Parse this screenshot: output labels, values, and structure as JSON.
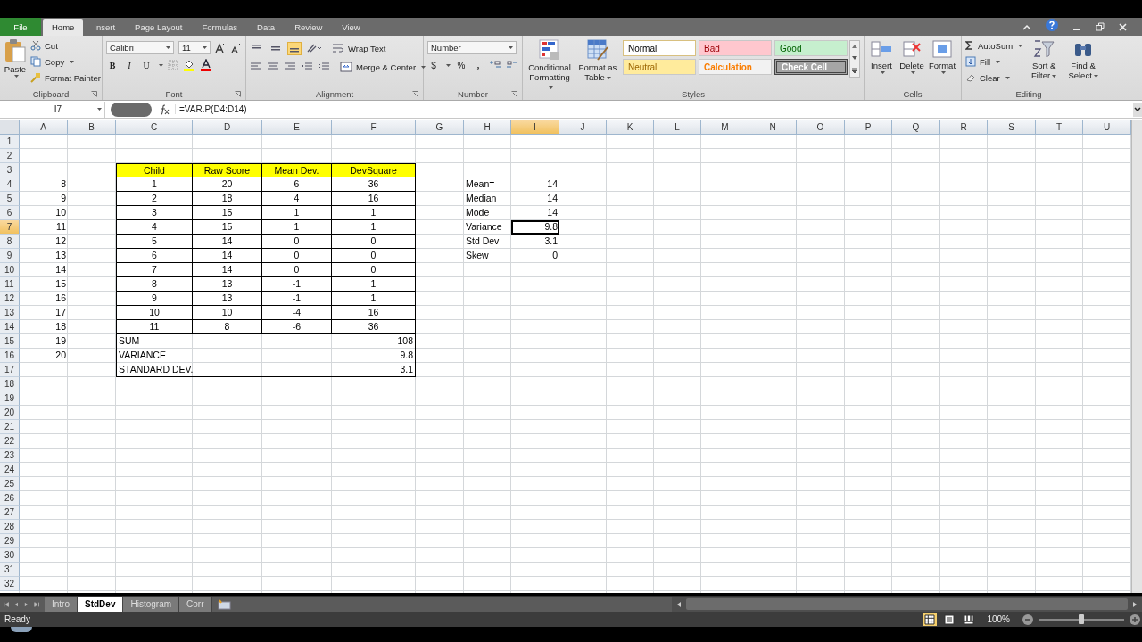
{
  "ribbon_tabs": [
    {
      "label": "File",
      "kind": "file",
      "selected": false
    },
    {
      "label": "Home",
      "kind": "tab",
      "selected": true
    },
    {
      "label": "Insert",
      "kind": "tab",
      "selected": false
    },
    {
      "label": "Page Layout",
      "kind": "tab",
      "selected": false
    },
    {
      "label": "Formulas",
      "kind": "tab",
      "selected": false
    },
    {
      "label": "Data",
      "kind": "tab",
      "selected": false
    },
    {
      "label": "Review",
      "kind": "tab",
      "selected": false
    },
    {
      "label": "View",
      "kind": "tab",
      "selected": false
    }
  ],
  "ribbon": {
    "clipboard": {
      "title": "Clipboard",
      "paste": "Paste",
      "cut": "Cut",
      "copy": "Copy",
      "format_painter": "Format Painter"
    },
    "font": {
      "title": "Font",
      "name": "Calibri",
      "size": "11",
      "bold": "B",
      "italic": "I",
      "underline": "U"
    },
    "alignment": {
      "title": "Alignment",
      "vertical": [
        {
          "selected": false
        },
        {
          "selected": false
        },
        {
          "selected": true
        }
      ],
      "wrap_text": "Wrap Text",
      "merge_center": "Merge & Center"
    },
    "number": {
      "title": "Number",
      "format": "Number",
      "currency": "$",
      "percent": "%",
      "comma": ","
    },
    "styles": {
      "title": "Styles",
      "conditional_formatting": "Conditional Formatting",
      "format_as_table": "Format as Table",
      "cell_styles": [
        {
          "label": "Normal",
          "kind": "normal"
        },
        {
          "label": "Bad",
          "kind": "bad"
        },
        {
          "label": "Good",
          "kind": "good"
        },
        {
          "label": "Neutral",
          "kind": "neutral"
        },
        {
          "label": "Calculation",
          "kind": "calculation"
        },
        {
          "label": "Check Cell",
          "kind": "check"
        }
      ]
    },
    "cells": {
      "title": "Cells",
      "insert": "Insert",
      "delete": "Delete",
      "format": "Format"
    },
    "editing": {
      "title": "Editing",
      "autosum": "AutoSum",
      "fill": "Fill",
      "clear": "Clear",
      "sort_filter": "Sort & Filter",
      "find_select": "Find & Select"
    }
  },
  "formula_bar": {
    "name_box": "I7",
    "formula": "=VAR.P(D4:D14)"
  },
  "sheet": {
    "columns": [
      {
        "label": "A",
        "selected": false
      },
      {
        "label": "B",
        "selected": false
      },
      {
        "label": "C",
        "selected": false
      },
      {
        "label": "D",
        "selected": false
      },
      {
        "label": "E",
        "selected": false
      },
      {
        "label": "F",
        "selected": false
      },
      {
        "label": "G",
        "selected": false
      },
      {
        "label": "H",
        "selected": false
      },
      {
        "label": "I",
        "selected": true
      },
      {
        "label": "J",
        "selected": false
      },
      {
        "label": "K",
        "selected": false
      },
      {
        "label": "L",
        "selected": false
      },
      {
        "label": "M",
        "selected": false
      },
      {
        "label": "N",
        "selected": false
      },
      {
        "label": "O",
        "selected": false
      },
      {
        "label": "P",
        "selected": false
      },
      {
        "label": "Q",
        "selected": false
      },
      {
        "label": "R",
        "selected": false
      },
      {
        "label": "S",
        "selected": false
      },
      {
        "label": "T",
        "selected": false
      },
      {
        "label": "U",
        "selected": false
      }
    ],
    "rows": [
      {
        "label": "1",
        "kind": "plain",
        "selected": false,
        "cells": {}
      },
      {
        "label": "2",
        "kind": "plain",
        "selected": false,
        "cells": {}
      },
      {
        "label": "3",
        "kind": "table_header",
        "selected": false,
        "cells": {
          "C": "Child",
          "D": "Raw Score",
          "E": "Mean Dev.",
          "F": "DevSquare"
        }
      },
      {
        "label": "4",
        "kind": "table_row",
        "selected": false,
        "cells": {
          "A": "8",
          "C": "1",
          "D": "20",
          "E": "6",
          "F": "36",
          "H": "Mean=",
          "I": "14"
        }
      },
      {
        "label": "5",
        "kind": "table_row",
        "selected": false,
        "cells": {
          "A": "9",
          "C": "2",
          "D": "18",
          "E": "4",
          "F": "16",
          "H": "Median",
          "I": "14"
        }
      },
      {
        "label": "6",
        "kind": "table_row",
        "selected": false,
        "cells": {
          "A": "10",
          "C": "3",
          "D": "15",
          "E": "1",
          "F": "1",
          "H": "Mode",
          "I": "14"
        }
      },
      {
        "label": "7",
        "kind": "table_row",
        "selected": true,
        "cells": {
          "A": "11",
          "C": "4",
          "D": "15",
          "E": "1",
          "F": "1",
          "H": "Variance",
          "I": "9.8"
        }
      },
      {
        "label": "8",
        "kind": "table_row",
        "selected": false,
        "cells": {
          "A": "12",
          "C": "5",
          "D": "14",
          "E": "0",
          "F": "0",
          "H": "Std Dev",
          "I": "3.1"
        }
      },
      {
        "label": "9",
        "kind": "table_row",
        "selected": false,
        "cells": {
          "A": "13",
          "C": "6",
          "D": "14",
          "E": "0",
          "F": "0",
          "H": "Skew",
          "I": "0"
        }
      },
      {
        "label": "10",
        "kind": "table_row",
        "selected": false,
        "cells": {
          "A": "14",
          "C": "7",
          "D": "14",
          "E": "0",
          "F": "0"
        }
      },
      {
        "label": "11",
        "kind": "table_row",
        "selected": false,
        "cells": {
          "A": "15",
          "C": "8",
          "D": "13",
          "E": "-1",
          "F": "1"
        }
      },
      {
        "label": "12",
        "kind": "table_row",
        "selected": false,
        "cells": {
          "A": "16",
          "C": "9",
          "D": "13",
          "E": "-1",
          "F": "1"
        }
      },
      {
        "label": "13",
        "kind": "table_row",
        "selected": false,
        "cells": {
          "A": "17",
          "C": "10",
          "D": "10",
          "E": "-4",
          "F": "16"
        }
      },
      {
        "label": "14",
        "kind": "table_row",
        "selected": false,
        "cells": {
          "A": "18",
          "C": "11",
          "D": "8",
          "E": "-6",
          "F": "36"
        }
      },
      {
        "label": "15",
        "kind": "table_footer",
        "selected": false,
        "cells": {
          "A": "19",
          "C": "SUM",
          "F": "108"
        }
      },
      {
        "label": "16",
        "kind": "table_footer",
        "selected": false,
        "cells": {
          "A": "20",
          "C": "VARIANCE",
          "F": "9.8"
        }
      },
      {
        "label": "17",
        "kind": "table_footer_end",
        "selected": false,
        "cells": {
          "C": "STANDARD DEV.",
          "F": "3.1"
        }
      },
      {
        "label": "18",
        "kind": "plain",
        "selected": false,
        "cells": {}
      },
      {
        "label": "19",
        "kind": "plain",
        "selected": false,
        "cells": {}
      },
      {
        "label": "20",
        "kind": "plain",
        "selected": false,
        "cells": {}
      },
      {
        "label": "21",
        "kind": "plain",
        "selected": false,
        "cells": {}
      },
      {
        "label": "22",
        "kind": "plain",
        "selected": false,
        "cells": {}
      },
      {
        "label": "23",
        "kind": "plain",
        "selected": false,
        "cells": {}
      },
      {
        "label": "24",
        "kind": "plain",
        "selected": false,
        "cells": {}
      },
      {
        "label": "25",
        "kind": "plain",
        "selected": false,
        "cells": {}
      },
      {
        "label": "26",
        "kind": "plain",
        "selected": false,
        "cells": {}
      },
      {
        "label": "27",
        "kind": "plain",
        "selected": false,
        "cells": {}
      },
      {
        "label": "28",
        "kind": "plain",
        "selected": false,
        "cells": {}
      },
      {
        "label": "29",
        "kind": "plain",
        "selected": false,
        "cells": {}
      },
      {
        "label": "30",
        "kind": "plain",
        "selected": false,
        "cells": {}
      },
      {
        "label": "31",
        "kind": "plain",
        "selected": false,
        "cells": {}
      },
      {
        "label": "32",
        "kind": "plain",
        "selected": false,
        "cells": {}
      }
    ]
  },
  "sheet_tabs": [
    {
      "label": "Intro",
      "selected": false
    },
    {
      "label": "StdDev",
      "selected": true
    },
    {
      "label": "Histogram",
      "selected": false
    },
    {
      "label": "Corr",
      "selected": false
    }
  ],
  "status_bar": {
    "status": "Ready",
    "views": [
      {
        "selected": true
      },
      {
        "selected": false
      },
      {
        "selected": false
      }
    ],
    "zoom": "100%",
    "zoom_slider": {
      "level": 0.5
    }
  }
}
